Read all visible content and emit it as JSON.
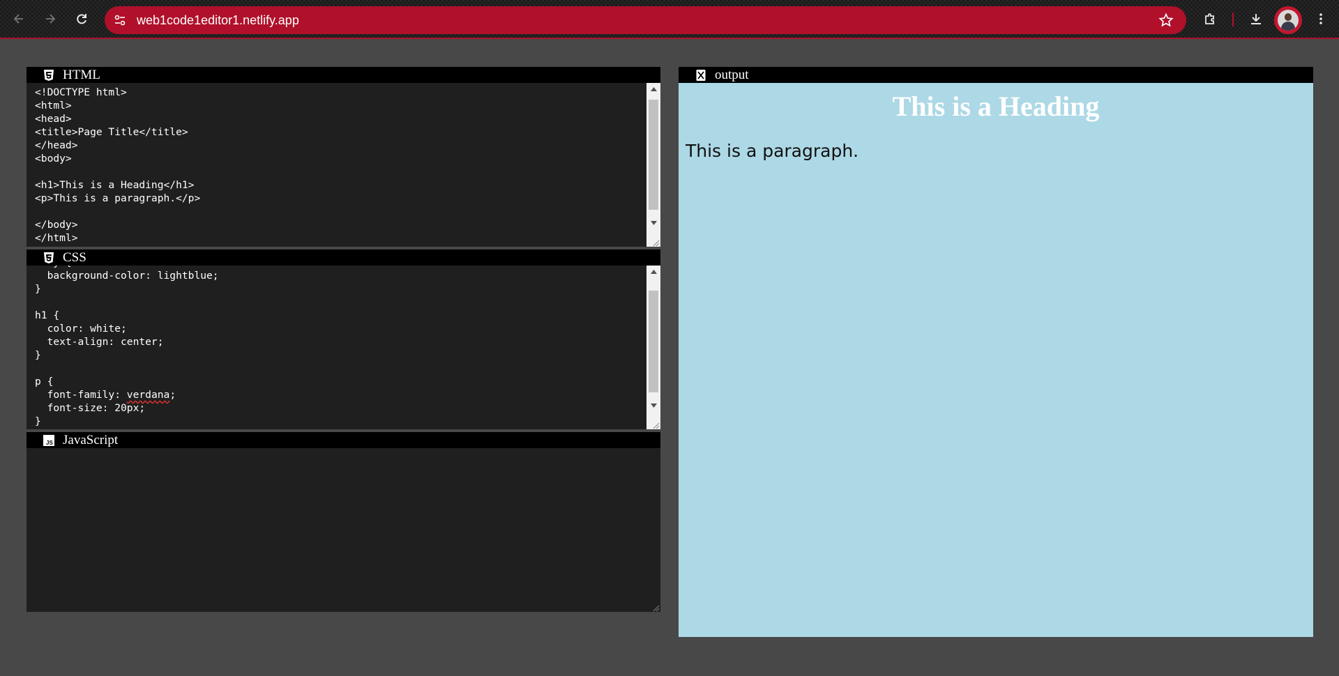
{
  "browser": {
    "url": "web1code1editor1.netlify.app",
    "accent_color": "#b0102a"
  },
  "html_panel": {
    "title": "HTML",
    "icon": "html5-icon",
    "lines": [
      "<!DOCTYPE html>",
      "<html>",
      "<head>",
      "<title>Page Title</title>",
      "</head>",
      "<body>",
      "",
      "<h1>This is a Heading</h1>",
      "<p>This is a paragraph.</p>",
      "",
      "</body>",
      "</html>"
    ]
  },
  "css_panel": {
    "title": "CSS",
    "icon": "css3-icon",
    "partial_first_line": "body {",
    "lines": [
      "  background-color: lightblue;",
      "}",
      "",
      "h1 {",
      "  color: white;",
      "  text-align: center;",
      "}",
      "",
      "p {",
      "  font-family: verdana;",
      "  font-size: 20px;",
      "}"
    ]
  },
  "js_panel": {
    "title": "JavaScript",
    "icon": "js-icon",
    "content": ""
  },
  "output_panel": {
    "title": "output",
    "icon": "output-icon",
    "heading": "This is a Heading",
    "paragraph": "This is a paragraph.",
    "background_color": "#add8e6"
  }
}
